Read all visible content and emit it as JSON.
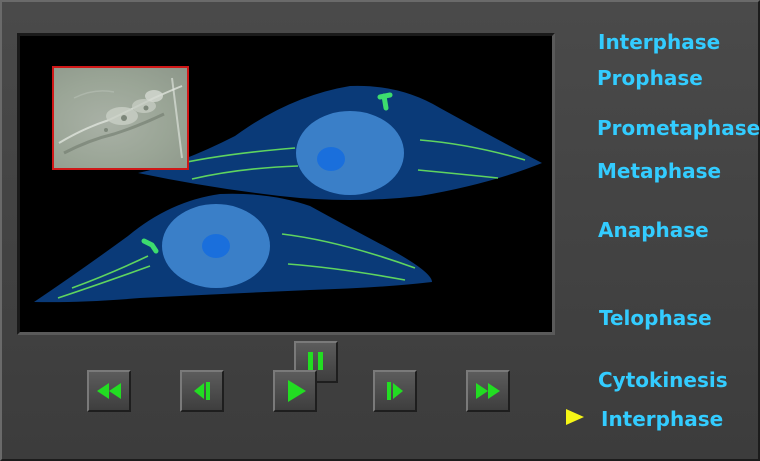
{
  "phases": [
    {
      "label": "Interphase"
    },
    {
      "label": "Prophase"
    },
    {
      "label": "Prometaphase"
    },
    {
      "label": "Metaphase"
    },
    {
      "label": "Anaphase"
    },
    {
      "label": "Telophase"
    },
    {
      "label": "Cytokinesis"
    },
    {
      "label": "Interphase"
    }
  ],
  "current_phase_index": 7,
  "controls": {
    "rewind": "rewind-icon",
    "step_back": "step-back-icon",
    "play": "play-icon",
    "pause": "pause-icon",
    "step_forward": "step-forward-icon",
    "fast_forward": "fast-forward-icon"
  },
  "colors": {
    "phase_text": "#33ccff",
    "button_glyph": "#22dd22",
    "current_arrow": "#f6f616",
    "cell_body": "#0a3a78",
    "nucleus": "#3a7fc8",
    "nucleolus": "#1a6fdc",
    "fiber": "#5fd45f",
    "inset_border": "#d01818"
  }
}
